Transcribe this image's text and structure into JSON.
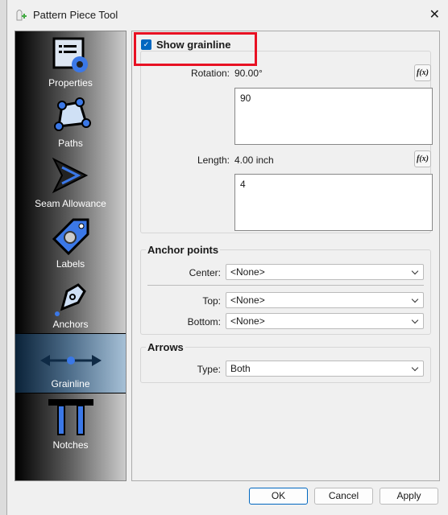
{
  "window": {
    "title": "Pattern Piece Tool",
    "close": "✕"
  },
  "sidebar": {
    "items": [
      {
        "label": "Properties"
      },
      {
        "label": "Paths"
      },
      {
        "label": "Seam Allowance"
      },
      {
        "label": "Labels"
      },
      {
        "label": "Anchors"
      },
      {
        "label": "Grainline",
        "active": true
      },
      {
        "label": "Notches"
      }
    ]
  },
  "grainline": {
    "show_label": "Show grainline",
    "checked": true,
    "rotation_label": "Rotation:",
    "rotation_value": "90.00°",
    "rotation_formula": "90",
    "length_label": "Length:",
    "length_value": "4.00 inch",
    "length_formula": "4",
    "fx_label": "f(x)"
  },
  "anchor_points": {
    "title": "Anchor points",
    "center_label": "Center:",
    "center_value": "<None>",
    "top_label": "Top:",
    "top_value": "<None>",
    "bottom_label": "Bottom:",
    "bottom_value": "<None>"
  },
  "arrows": {
    "title": "Arrows",
    "type_label": "Type:",
    "type_value": "Both"
  },
  "buttons": {
    "ok": "OK",
    "cancel": "Cancel",
    "apply": "Apply"
  },
  "colors": {
    "accent": "#0067c0",
    "highlight": "#e81123",
    "icon_blue": "#3b78e7"
  }
}
